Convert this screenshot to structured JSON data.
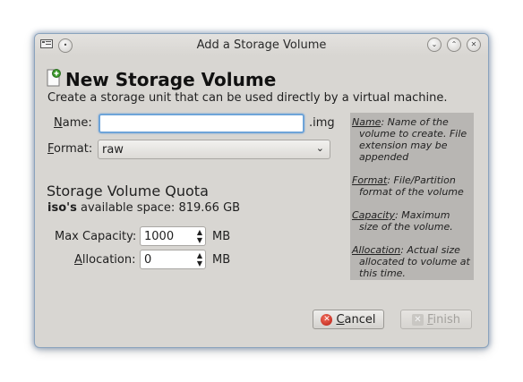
{
  "window": {
    "title": "Add a Storage Volume"
  },
  "header": {
    "title": "New Storage Volume",
    "subtitle": "Create a storage unit that can be used directly by a virtual machine."
  },
  "form": {
    "name_label_mnemonic": "N",
    "name_label_rest": "ame:",
    "name_value": "",
    "name_suffix": ".img",
    "format_label_mnemonic": "F",
    "format_label_rest": "ormat:",
    "format_value": "raw"
  },
  "quota": {
    "title": "Storage Volume Quota",
    "pool_name": "iso's",
    "available_text": "available space: 819.66 GB",
    "max_capacity_label": "Max Capacity:",
    "max_capacity_value": "1000",
    "max_capacity_unit": "MB",
    "allocation_label_mnemonic": "A",
    "allocation_label_rest": "llocation:",
    "allocation_value": "0",
    "allocation_unit": "MB"
  },
  "help": {
    "name_term": "Name",
    "name_desc": ": Name of the volume to create. File extension may be appended",
    "format_term": "Format",
    "format_desc": ": File/Partition format of the volume",
    "capacity_term": "Capacity",
    "capacity_desc": ": Maximum size of the volume.",
    "allocation_term": "Allocation",
    "allocation_desc": ": Actual size allocated to volume at this time."
  },
  "buttons": {
    "cancel_mnemonic": "C",
    "cancel_rest": "ancel",
    "finish_mnemonic": "F",
    "finish_rest": "inish"
  },
  "colors": {
    "window_bg": "#d8d6d2",
    "focus_border": "#6ea4d8",
    "cancel_icon": "#d7332a"
  }
}
